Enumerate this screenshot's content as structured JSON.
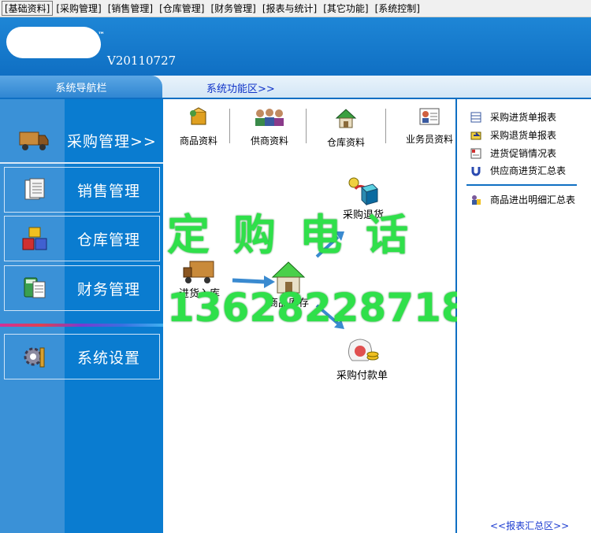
{
  "menu": [
    "[基础资料]",
    "[采购管理]",
    "[销售管理]",
    "[仓库管理]",
    "[财务管理]",
    "[报表与统计]",
    "[其它功能]",
    "[系统控制]"
  ],
  "header": {
    "trademark": "™",
    "version": "V20110727"
  },
  "tabs": {
    "nav": "系统导航栏",
    "func": "系统功能区>>"
  },
  "nav": {
    "purchase": "采购管理>>",
    "sales": "销售管理",
    "warehouse": "仓库管理",
    "finance": "财务管理",
    "settings": "系统设置"
  },
  "toolbar": {
    "goods": "商品资料",
    "suppliers": "供商资料",
    "warehouse": "仓库资料",
    "staff": "业务员资料"
  },
  "flow": {
    "return": "采购退货",
    "stock_in": "进货入库",
    "inventory": "商品库存",
    "payment": "采购付款单"
  },
  "promo": {
    "line1": "定购电话",
    "line2": "13628228718"
  },
  "reports": {
    "items": [
      "采购进货单报表",
      "采购退货单报表",
      "进货促销情况表",
      "供应商进货汇总表"
    ],
    "detail": "商品进出明细汇总表",
    "summary_link": "<<报表汇总区>>"
  },
  "colors": {
    "banner": "#1e86d6",
    "nav_bg": "#0a7cd0",
    "promo": "#2fe04a",
    "link": "#1a3ad0"
  }
}
